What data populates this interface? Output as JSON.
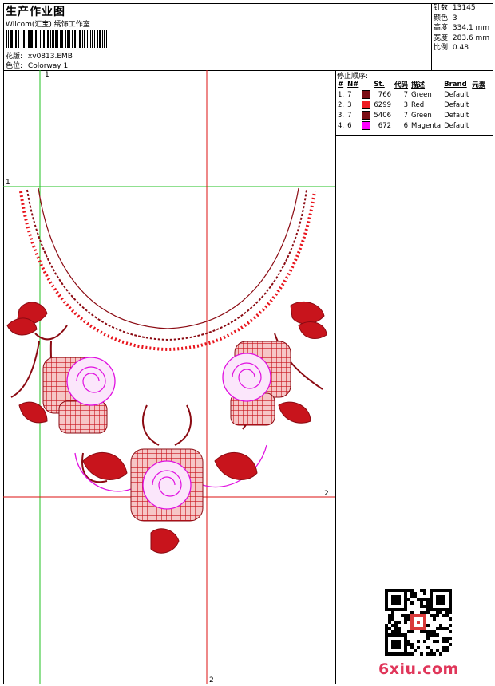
{
  "header": {
    "title": "生产作业图",
    "company": "Wilcom(汇宝) 绣饰工作室",
    "design_label": "花版:",
    "design_value": "xv0813.EMB",
    "colorway_label": "色位:",
    "colorway_value": "Colorway 1"
  },
  "stats": [
    {
      "label": "针数:",
      "value": "13145"
    },
    {
      "label": "颜色:",
      "value": "3"
    },
    {
      "label": "高度:",
      "value": "334.1 mm"
    },
    {
      "label": "宽度:",
      "value": "283.6 mm"
    },
    {
      "label": "比例:",
      "value": "0.48"
    }
  ],
  "stop_sequence": {
    "title": "停止顺序:",
    "columns": [
      "#",
      "N#",
      "St.",
      "代码",
      "描述",
      "Brand",
      "元素"
    ],
    "rows": [
      {
        "idx": "1.",
        "n": "7",
        "color": "#7a0d14",
        "st": "766",
        "code": "7",
        "desc": "Green",
        "brand": "Default"
      },
      {
        "idx": "2.",
        "n": "3",
        "color": "#ee1c24",
        "st": "6299",
        "code": "3",
        "desc": "Red",
        "brand": "Default"
      },
      {
        "idx": "3.",
        "n": "7",
        "color": "#7a0d14",
        "st": "5406",
        "code": "7",
        "desc": "Green",
        "brand": "Default"
      },
      {
        "idx": "4.",
        "n": "6",
        "color": "#ff00ff",
        "st": "672",
        "code": "6",
        "desc": "Magenta",
        "brand": "Default"
      }
    ]
  },
  "guides": {
    "v1_label": "1",
    "h1_label": "1",
    "h2_label": "2",
    "v2_label": "2"
  },
  "watermark": "6xiu.com",
  "palette": {
    "dark_red": "#8b0a12",
    "red": "#e8141c",
    "magenta": "#e010e0",
    "green_guide": "#22c022",
    "red_guide": "#dd1111"
  }
}
